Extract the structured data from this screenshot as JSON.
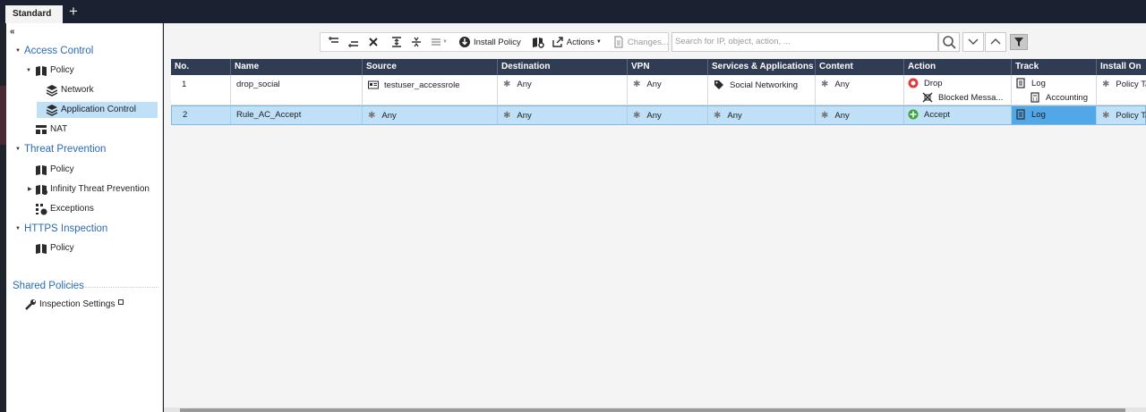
{
  "tabs": [
    {
      "label": "Standard"
    }
  ],
  "add_tab_symbol": "+",
  "sidebar": {
    "collapse_symbol": "«",
    "items": [
      {
        "label": "Access Control"
      },
      {
        "label": "Policy"
      },
      {
        "label": "Network"
      },
      {
        "label": "Application Control"
      },
      {
        "label": "NAT"
      },
      {
        "label": "Threat Prevention"
      },
      {
        "label": "Policy"
      },
      {
        "label": "Infinity Threat Prevention"
      },
      {
        "label": "Exceptions"
      },
      {
        "label": "HTTPS Inspection"
      },
      {
        "label": "Policy"
      },
      {
        "label": "Shared Policies"
      },
      {
        "label": "Inspection Settings"
      }
    ]
  },
  "toolbar": {
    "install_policy": "Install Policy",
    "actions": "Actions",
    "changes": "Changes...",
    "search_placeholder": "Search for IP, object, action, ..."
  },
  "table": {
    "columns": [
      "No.",
      "Name",
      "Source",
      "Destination",
      "VPN",
      "Services & Applications",
      "Content",
      "Action",
      "Track",
      "Install On"
    ],
    "rows": [
      {
        "no": "1",
        "name": "drop_social",
        "source": "testuser_accessrole",
        "destination": "Any",
        "vpn": "Any",
        "services": "Social Networking",
        "content": "Any",
        "action": "Drop",
        "action_sub": "Blocked Messa...",
        "track": "Log",
        "track_sub": "Accounting",
        "install_on": "Policy Targets"
      },
      {
        "no": "2",
        "name": "Rule_AC_Accept",
        "source": "Any",
        "destination": "Any",
        "vpn": "Any",
        "services": "Any",
        "content": "Any",
        "action": "Accept",
        "track": "Log",
        "install_on": "Policy Targets"
      }
    ]
  },
  "colors": {
    "header_bg": "#2f3c54",
    "selection": "#bfe0f7",
    "section_link": "#2a6bb5",
    "drop_red": "#e03a3a",
    "accept_green": "#3aa63a"
  }
}
